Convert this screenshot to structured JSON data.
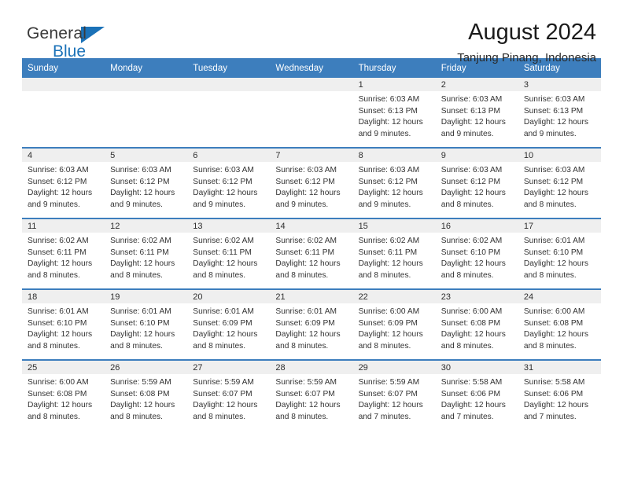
{
  "brand": {
    "name_top": "General",
    "name_bottom": "Blue",
    "triangle_color": "#1b72b8"
  },
  "header": {
    "title": "August 2024",
    "subtitle": "Tanjung Pinang, Indonesia",
    "header_bg_color": "#3d7ebd",
    "band_color": "#efefef"
  },
  "weekday_headers": [
    "Sunday",
    "Monday",
    "Tuesday",
    "Wednesday",
    "Thursday",
    "Friday",
    "Saturday"
  ],
  "labels": {
    "sunrise_prefix": "Sunrise: ",
    "sunset_prefix": "Sunset: ",
    "daylight_prefix": "Daylight: "
  },
  "weeks": [
    [
      {
        "day": "",
        "sunrise": "",
        "sunset": "",
        "daylight_line1": "",
        "daylight_line2": ""
      },
      {
        "day": "",
        "sunrise": "",
        "sunset": "",
        "daylight_line1": "",
        "daylight_line2": ""
      },
      {
        "day": "",
        "sunrise": "",
        "sunset": "",
        "daylight_line1": "",
        "daylight_line2": ""
      },
      {
        "day": "",
        "sunrise": "",
        "sunset": "",
        "daylight_line1": "",
        "daylight_line2": ""
      },
      {
        "day": "1",
        "sunrise": "Sunrise: 6:03 AM",
        "sunset": "Sunset: 6:13 PM",
        "daylight_line1": "Daylight: 12 hours",
        "daylight_line2": "and 9 minutes."
      },
      {
        "day": "2",
        "sunrise": "Sunrise: 6:03 AM",
        "sunset": "Sunset: 6:13 PM",
        "daylight_line1": "Daylight: 12 hours",
        "daylight_line2": "and 9 minutes."
      },
      {
        "day": "3",
        "sunrise": "Sunrise: 6:03 AM",
        "sunset": "Sunset: 6:13 PM",
        "daylight_line1": "Daylight: 12 hours",
        "daylight_line2": "and 9 minutes."
      }
    ],
    [
      {
        "day": "4",
        "sunrise": "Sunrise: 6:03 AM",
        "sunset": "Sunset: 6:12 PM",
        "daylight_line1": "Daylight: 12 hours",
        "daylight_line2": "and 9 minutes."
      },
      {
        "day": "5",
        "sunrise": "Sunrise: 6:03 AM",
        "sunset": "Sunset: 6:12 PM",
        "daylight_line1": "Daylight: 12 hours",
        "daylight_line2": "and 9 minutes."
      },
      {
        "day": "6",
        "sunrise": "Sunrise: 6:03 AM",
        "sunset": "Sunset: 6:12 PM",
        "daylight_line1": "Daylight: 12 hours",
        "daylight_line2": "and 9 minutes."
      },
      {
        "day": "7",
        "sunrise": "Sunrise: 6:03 AM",
        "sunset": "Sunset: 6:12 PM",
        "daylight_line1": "Daylight: 12 hours",
        "daylight_line2": "and 9 minutes."
      },
      {
        "day": "8",
        "sunrise": "Sunrise: 6:03 AM",
        "sunset": "Sunset: 6:12 PM",
        "daylight_line1": "Daylight: 12 hours",
        "daylight_line2": "and 9 minutes."
      },
      {
        "day": "9",
        "sunrise": "Sunrise: 6:03 AM",
        "sunset": "Sunset: 6:12 PM",
        "daylight_line1": "Daylight: 12 hours",
        "daylight_line2": "and 8 minutes."
      },
      {
        "day": "10",
        "sunrise": "Sunrise: 6:03 AM",
        "sunset": "Sunset: 6:12 PM",
        "daylight_line1": "Daylight: 12 hours",
        "daylight_line2": "and 8 minutes."
      }
    ],
    [
      {
        "day": "11",
        "sunrise": "Sunrise: 6:02 AM",
        "sunset": "Sunset: 6:11 PM",
        "daylight_line1": "Daylight: 12 hours",
        "daylight_line2": "and 8 minutes."
      },
      {
        "day": "12",
        "sunrise": "Sunrise: 6:02 AM",
        "sunset": "Sunset: 6:11 PM",
        "daylight_line1": "Daylight: 12 hours",
        "daylight_line2": "and 8 minutes."
      },
      {
        "day": "13",
        "sunrise": "Sunrise: 6:02 AM",
        "sunset": "Sunset: 6:11 PM",
        "daylight_line1": "Daylight: 12 hours",
        "daylight_line2": "and 8 minutes."
      },
      {
        "day": "14",
        "sunrise": "Sunrise: 6:02 AM",
        "sunset": "Sunset: 6:11 PM",
        "daylight_line1": "Daylight: 12 hours",
        "daylight_line2": "and 8 minutes."
      },
      {
        "day": "15",
        "sunrise": "Sunrise: 6:02 AM",
        "sunset": "Sunset: 6:11 PM",
        "daylight_line1": "Daylight: 12 hours",
        "daylight_line2": "and 8 minutes."
      },
      {
        "day": "16",
        "sunrise": "Sunrise: 6:02 AM",
        "sunset": "Sunset: 6:10 PM",
        "daylight_line1": "Daylight: 12 hours",
        "daylight_line2": "and 8 minutes."
      },
      {
        "day": "17",
        "sunrise": "Sunrise: 6:01 AM",
        "sunset": "Sunset: 6:10 PM",
        "daylight_line1": "Daylight: 12 hours",
        "daylight_line2": "and 8 minutes."
      }
    ],
    [
      {
        "day": "18",
        "sunrise": "Sunrise: 6:01 AM",
        "sunset": "Sunset: 6:10 PM",
        "daylight_line1": "Daylight: 12 hours",
        "daylight_line2": "and 8 minutes."
      },
      {
        "day": "19",
        "sunrise": "Sunrise: 6:01 AM",
        "sunset": "Sunset: 6:10 PM",
        "daylight_line1": "Daylight: 12 hours",
        "daylight_line2": "and 8 minutes."
      },
      {
        "day": "20",
        "sunrise": "Sunrise: 6:01 AM",
        "sunset": "Sunset: 6:09 PM",
        "daylight_line1": "Daylight: 12 hours",
        "daylight_line2": "and 8 minutes."
      },
      {
        "day": "21",
        "sunrise": "Sunrise: 6:01 AM",
        "sunset": "Sunset: 6:09 PM",
        "daylight_line1": "Daylight: 12 hours",
        "daylight_line2": "and 8 minutes."
      },
      {
        "day": "22",
        "sunrise": "Sunrise: 6:00 AM",
        "sunset": "Sunset: 6:09 PM",
        "daylight_line1": "Daylight: 12 hours",
        "daylight_line2": "and 8 minutes."
      },
      {
        "day": "23",
        "sunrise": "Sunrise: 6:00 AM",
        "sunset": "Sunset: 6:08 PM",
        "daylight_line1": "Daylight: 12 hours",
        "daylight_line2": "and 8 minutes."
      },
      {
        "day": "24",
        "sunrise": "Sunrise: 6:00 AM",
        "sunset": "Sunset: 6:08 PM",
        "daylight_line1": "Daylight: 12 hours",
        "daylight_line2": "and 8 minutes."
      }
    ],
    [
      {
        "day": "25",
        "sunrise": "Sunrise: 6:00 AM",
        "sunset": "Sunset: 6:08 PM",
        "daylight_line1": "Daylight: 12 hours",
        "daylight_line2": "and 8 minutes."
      },
      {
        "day": "26",
        "sunrise": "Sunrise: 5:59 AM",
        "sunset": "Sunset: 6:08 PM",
        "daylight_line1": "Daylight: 12 hours",
        "daylight_line2": "and 8 minutes."
      },
      {
        "day": "27",
        "sunrise": "Sunrise: 5:59 AM",
        "sunset": "Sunset: 6:07 PM",
        "daylight_line1": "Daylight: 12 hours",
        "daylight_line2": "and 8 minutes."
      },
      {
        "day": "28",
        "sunrise": "Sunrise: 5:59 AM",
        "sunset": "Sunset: 6:07 PM",
        "daylight_line1": "Daylight: 12 hours",
        "daylight_line2": "and 8 minutes."
      },
      {
        "day": "29",
        "sunrise": "Sunrise: 5:59 AM",
        "sunset": "Sunset: 6:07 PM",
        "daylight_line1": "Daylight: 12 hours",
        "daylight_line2": "and 7 minutes."
      },
      {
        "day": "30",
        "sunrise": "Sunrise: 5:58 AM",
        "sunset": "Sunset: 6:06 PM",
        "daylight_line1": "Daylight: 12 hours",
        "daylight_line2": "and 7 minutes."
      },
      {
        "day": "31",
        "sunrise": "Sunrise: 5:58 AM",
        "sunset": "Sunset: 6:06 PM",
        "daylight_line1": "Daylight: 12 hours",
        "daylight_line2": "and 7 minutes."
      }
    ]
  ]
}
